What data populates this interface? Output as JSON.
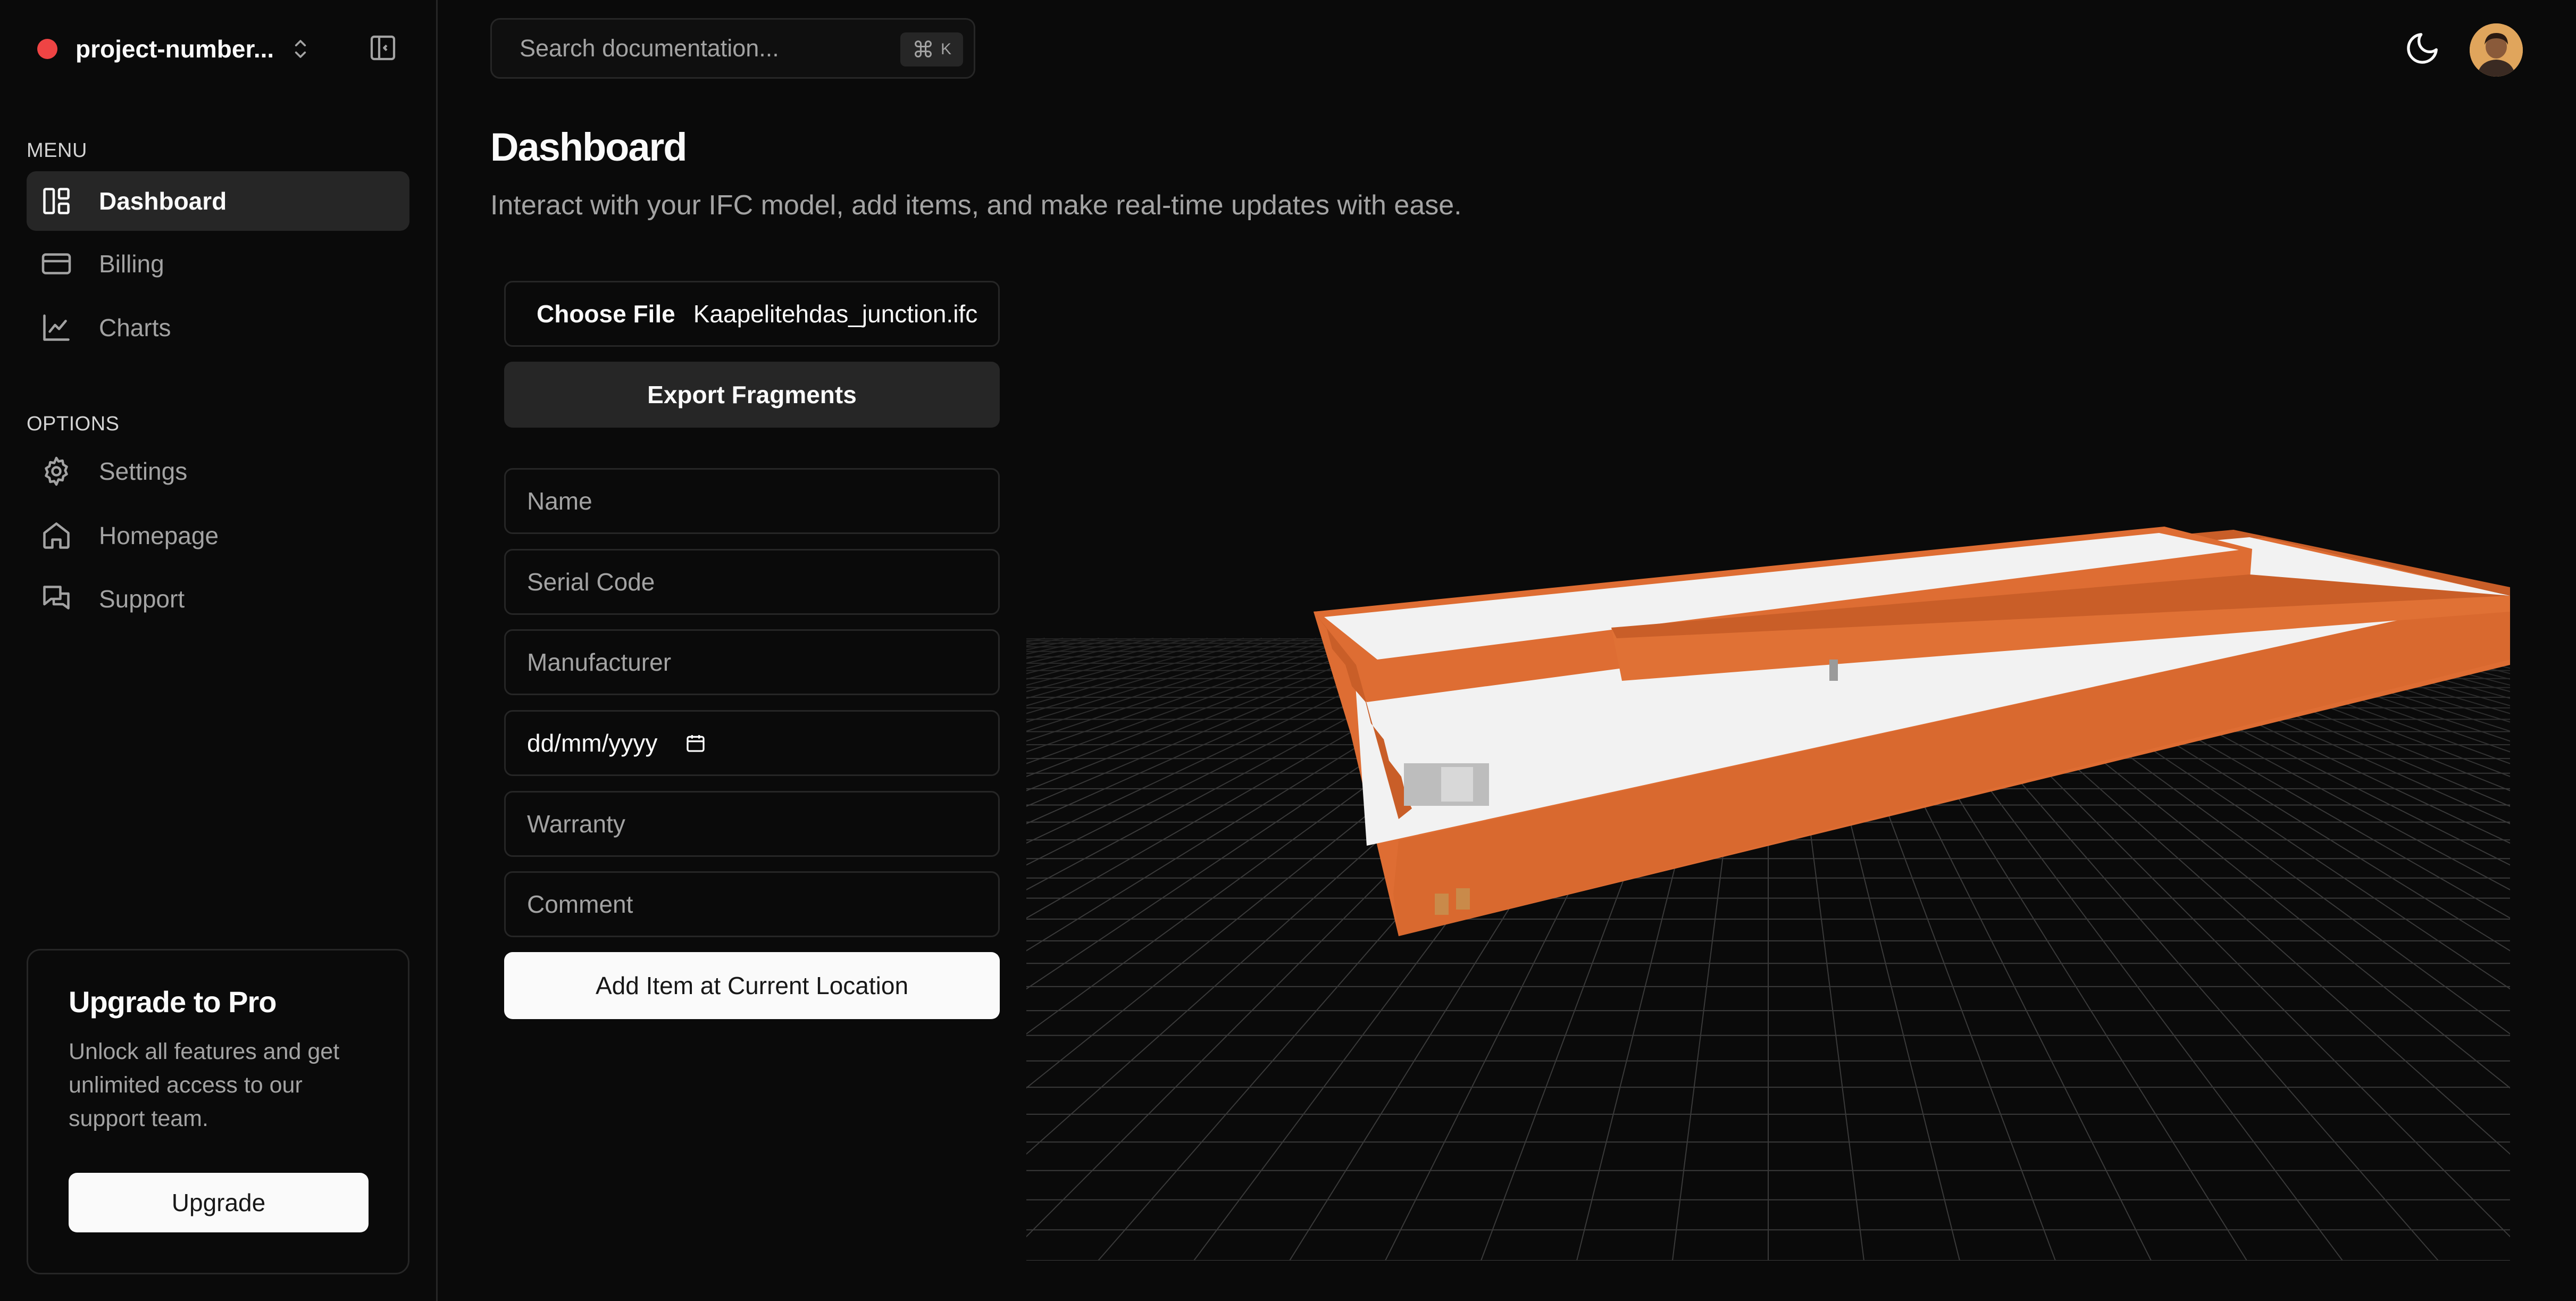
{
  "sidebar": {
    "project_name": "project-number...",
    "menu_label": "MENU",
    "options_label": "OPTIONS",
    "menu_items": [
      {
        "label": "Dashboard",
        "icon": "dashboard-icon",
        "active": true
      },
      {
        "label": "Billing",
        "icon": "credit-card-icon"
      },
      {
        "label": "Charts",
        "icon": "line-chart-icon"
      }
    ],
    "option_items": [
      {
        "label": "Settings",
        "icon": "gear-icon"
      },
      {
        "label": "Homepage",
        "icon": "home-icon"
      },
      {
        "label": "Support",
        "icon": "chat-icon"
      }
    ],
    "upgrade": {
      "title": "Upgrade to Pro",
      "description": "Unlock all features and get unlimited access to our support team.",
      "button": "Upgrade"
    }
  },
  "header": {
    "search_placeholder": "Search documentation...",
    "shortcut_symbol": "⌘",
    "shortcut_key": "K"
  },
  "main": {
    "title": "Dashboard",
    "subtitle": "Interact with your IFC model, add items, and make real-time updates with ease.",
    "file_input": {
      "button": "Choose File",
      "file_name": "Kaapelitehdas_junction.ifc"
    },
    "export_button": "Export Fragments",
    "fields": {
      "name_placeholder": "Name",
      "serial_placeholder": "Serial Code",
      "manufacturer_placeholder": "Manufacturer",
      "date_placeholder": "dd/mm/yyyy",
      "warranty_placeholder": "Warranty",
      "comment_placeholder": "Comment"
    },
    "add_button": "Add Item at Current Location"
  },
  "colors": {
    "background": "#0a0a0a",
    "border": "#262626",
    "accent_dot": "#ef4444",
    "model_wall": "#de6d33",
    "model_floor": "#f2f2f2"
  }
}
